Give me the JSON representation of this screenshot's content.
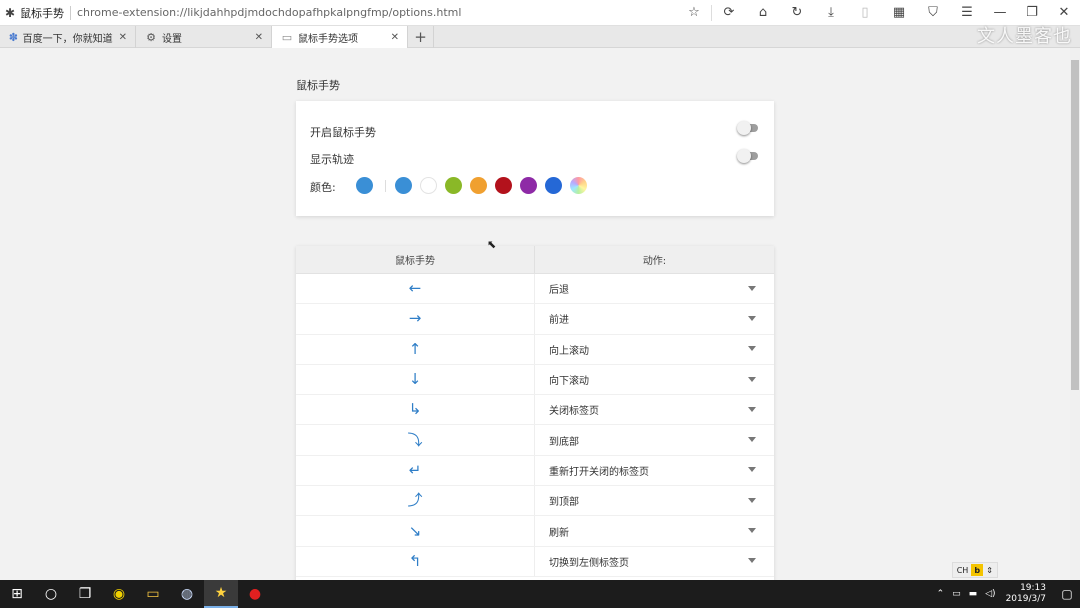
{
  "window": {
    "page_title": "鼠标手势",
    "url": "chrome-extension://likjdahhpdjmdochdopafhpkalpngfmp/options.html",
    "toolbar_icons": [
      "star-icon",
      "sync-icon",
      "home-icon",
      "refresh-icon",
      "download-icon",
      "mouse-icon",
      "qr-icon",
      "shield-icon",
      "menu-icon",
      "minimize-icon",
      "restore-icon",
      "close-icon"
    ]
  },
  "tabs": [
    {
      "label": "百度一下，你就知道",
      "icon": "baidu-icon"
    },
    {
      "label": "设置",
      "icon": "gear-icon"
    },
    {
      "label": "鼠标手势选项",
      "icon": "page-icon",
      "active": true
    }
  ],
  "watermark": "文人墨客也",
  "settings": {
    "section_title": "鼠标手势",
    "enable_label": "开启鼠标手势",
    "enable_on": false,
    "trail_label": "显示轨迹",
    "trail_on": false,
    "color_label": "颜色:",
    "current_color": "#3a8fd6",
    "colors": [
      "#3a8fd6",
      "#ffffff",
      "#8ab827",
      "#f0a030",
      "#b3121c",
      "#8e2aa6",
      "#2568d6",
      "rainbow"
    ]
  },
  "gestures": {
    "header_gesture": "鼠标手势",
    "header_action": "动作:",
    "rows": [
      {
        "arrow": "←",
        "icon": "arrow-left-icon",
        "action": "后退"
      },
      {
        "arrow": "→",
        "icon": "arrow-right-icon",
        "action": "前进"
      },
      {
        "arrow": "↑",
        "icon": "arrow-up-icon",
        "action": "向上滚动"
      },
      {
        "arrow": "↓",
        "icon": "arrow-down-icon",
        "action": "向下滚动"
      },
      {
        "arrow": "↳",
        "icon": "arrow-down-right-icon",
        "action": "关闭标签页"
      },
      {
        "arrow": "⤵",
        "icon": "arrow-right-down-icon",
        "action": "到底部"
      },
      {
        "arrow": "↵",
        "icon": "arrow-up-left-icon",
        "action": "重新打开关闭的标签页"
      },
      {
        "arrow": "⤴",
        "icon": "arrow-right-up-icon",
        "action": "到顶部"
      },
      {
        "arrow": "↘",
        "icon": "arrow-up-diagonal-icon",
        "action": "刷新"
      },
      {
        "arrow": "↰",
        "icon": "arrow-up-left-turn-icon",
        "action": "切换到左侧标签页"
      }
    ]
  },
  "ime": {
    "text": "CH",
    "key": "b"
  },
  "taskbar": {
    "time": "19:13",
    "date": "2019/3/7",
    "apps": [
      "start-icon",
      "search-icon",
      "taskview-icon",
      "app-icon-1",
      "explorer-icon",
      "app-icon-3",
      "browser-icon",
      "record-icon"
    ]
  }
}
